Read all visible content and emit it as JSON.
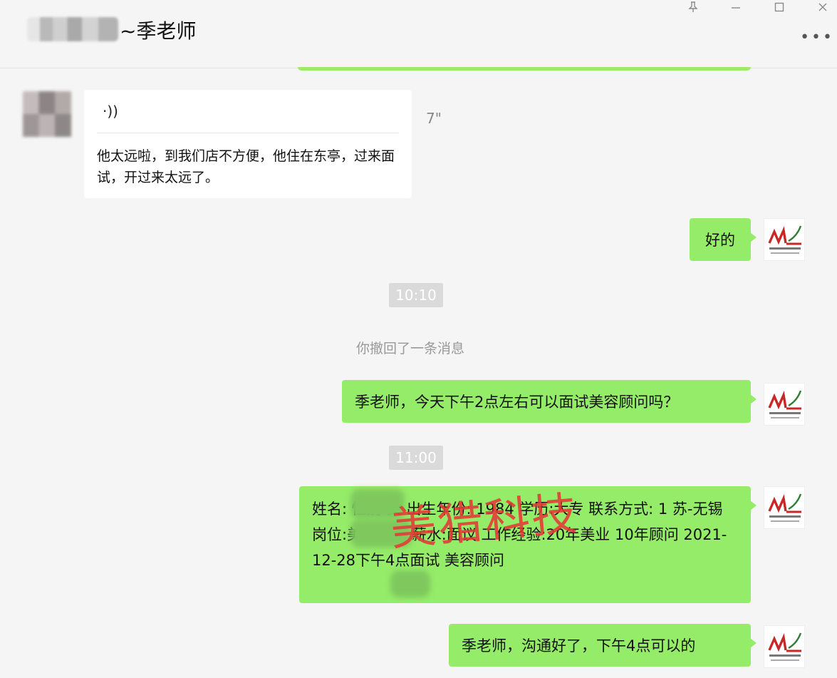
{
  "window": {
    "title": "~季老师",
    "controls": {
      "pin": "pin-icon",
      "minimize": "minimize-icon",
      "maximize": "maximize-icon",
      "more": "more-icon"
    }
  },
  "messages": {
    "voice": {
      "text": "他太远啦，到我们店不方便，他住在东亭，过来面试，开过来太远了。",
      "duration": "7\""
    },
    "reply_ok": "好的",
    "time_1": "10:10",
    "recall_notice": "你撤回了一条消息",
    "question": "季老师，今天下午2点左右可以面试美容顾问吗？",
    "time_2": "11:00",
    "candidate_info": "姓名:        性别:女 出生年份: 1984 学历:大专 联系方式: 1                           苏-无锡 岗位:美容顾问 薪水:面议 工作经验:20年美业 10年顾问 2021-12-28下午4点面试       美容顾问",
    "confirm": "季老师，沟通好了，下午4点可以的"
  },
  "watermark": "美猎科技",
  "colors": {
    "bubble_green": "#95ec69",
    "background": "#f5f5f5",
    "watermark_red": "#e53935"
  }
}
